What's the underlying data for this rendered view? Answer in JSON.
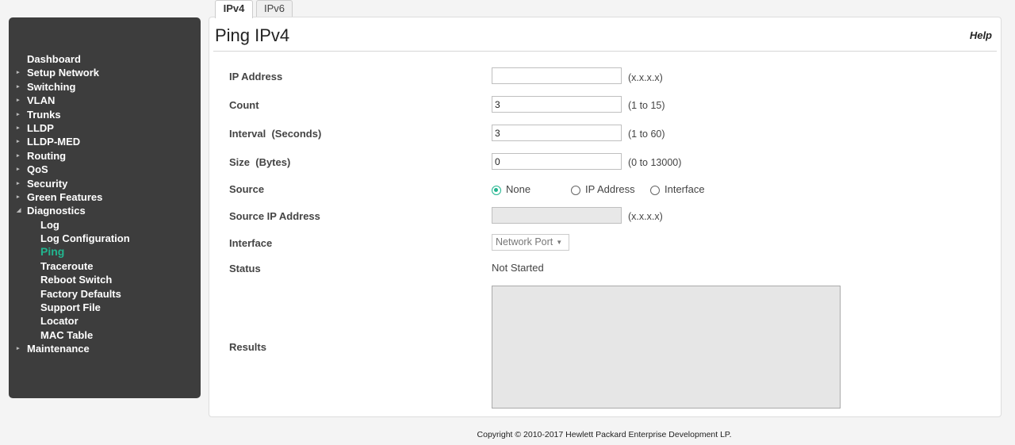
{
  "sidebar": {
    "items": [
      {
        "label": "Dashboard",
        "type": "top",
        "arrow": ""
      },
      {
        "label": "Setup Network",
        "type": "top",
        "arrow": "▸"
      },
      {
        "label": "Switching",
        "type": "top",
        "arrow": "▸"
      },
      {
        "label": "VLAN",
        "type": "top",
        "arrow": "▸"
      },
      {
        "label": "Trunks",
        "type": "top",
        "arrow": "▸"
      },
      {
        "label": "LLDP",
        "type": "top",
        "arrow": "▸"
      },
      {
        "label": "LLDP-MED",
        "type": "top",
        "arrow": "▸"
      },
      {
        "label": "Routing",
        "type": "top",
        "arrow": "▸"
      },
      {
        "label": "QoS",
        "type": "top",
        "arrow": "▸"
      },
      {
        "label": "Security",
        "type": "top",
        "arrow": "▸"
      },
      {
        "label": "Green Features",
        "type": "top",
        "arrow": "▸"
      },
      {
        "label": "Diagnostics",
        "type": "top",
        "arrow": "◢"
      },
      {
        "label": "Log",
        "type": "sub",
        "arrow": ""
      },
      {
        "label": "Log Configuration",
        "type": "sub",
        "arrow": ""
      },
      {
        "label": "Ping",
        "type": "sub",
        "arrow": "",
        "active": true
      },
      {
        "label": "Traceroute",
        "type": "sub",
        "arrow": ""
      },
      {
        "label": "Reboot Switch",
        "type": "sub",
        "arrow": ""
      },
      {
        "label": "Factory Defaults",
        "type": "sub",
        "arrow": ""
      },
      {
        "label": "Support File",
        "type": "sub",
        "arrow": ""
      },
      {
        "label": "Locator",
        "type": "sub",
        "arrow": ""
      },
      {
        "label": "MAC Table",
        "type": "sub",
        "arrow": ""
      },
      {
        "label": "Maintenance",
        "type": "top",
        "arrow": "▸"
      }
    ]
  },
  "tabs": [
    {
      "label": "IPv4",
      "selected": true
    },
    {
      "label": "IPv6",
      "selected": false
    }
  ],
  "page": {
    "title": "Ping IPv4",
    "help": "Help"
  },
  "form": {
    "ip_address": {
      "label": "IP Address",
      "value": "",
      "hint": "(x.x.x.x)"
    },
    "count": {
      "label": "Count",
      "value": "3",
      "hint": "(1 to 15)"
    },
    "interval": {
      "label": "Interval  (Seconds)",
      "value": "3",
      "hint": "(1 to 60)"
    },
    "size": {
      "label": "Size  (Bytes)",
      "value": "0",
      "hint": "(0 to 13000)"
    },
    "source": {
      "label": "Source",
      "options": [
        "None",
        "IP Address",
        "Interface"
      ],
      "selected": "None"
    },
    "source_ip": {
      "label": "Source IP Address",
      "value": "",
      "hint": "(x.x.x.x)"
    },
    "interface": {
      "label": "Interface",
      "selected": "Network Port"
    },
    "status": {
      "label": "Status",
      "value": "Not Started"
    },
    "results": {
      "label": "Results",
      "value": ""
    }
  },
  "footer": {
    "copyright": "Copyright © 2010-2017 Hewlett Packard Enterprise Development LP."
  },
  "colors": {
    "accent": "#22b58f",
    "sidebar_bg": "#3d3d3d"
  }
}
